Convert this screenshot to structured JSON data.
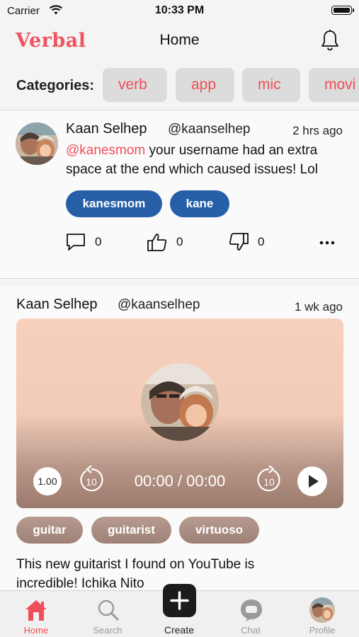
{
  "status_bar": {
    "carrier": "Carrier",
    "time": "10:33 PM"
  },
  "header": {
    "logo": "Verbal",
    "title": "Home"
  },
  "categories": {
    "label": "Categories:",
    "items": [
      "verb",
      "app",
      "mic",
      "movi"
    ]
  },
  "feed": {
    "post1": {
      "name": "Kaan Selhep",
      "handle": "@kaanselhep",
      "time": "2 hrs ago",
      "mention": "@kanesmom",
      "text_line1_rest": " your username had an extra",
      "text_line2": "space at the end which caused issues! Lol",
      "tags": [
        "kanesmom",
        "kane"
      ],
      "comments": "0",
      "likes": "0",
      "dislikes": "0"
    },
    "post2": {
      "name": "Kaan Selhep",
      "handle": "@kaanselhep",
      "time": "1 wk ago",
      "player": {
        "speed": "1.00",
        "timeline": "00:00 / 00:00",
        "skip_back": "10",
        "skip_forward": "10"
      },
      "tags": [
        "guitar",
        "guitarist",
        "virtuoso"
      ],
      "text_line1": "This new guitarist I found on YouTube is",
      "text_line2": "incredible! Ichika Nito"
    }
  },
  "tab_bar": {
    "home": "Home",
    "search": "Search",
    "create": "Create",
    "chat": "Chat",
    "profile": "Profile"
  },
  "colors": {
    "accent": "#ef4f58",
    "tag_blue": "#265fa8",
    "tag_brown": "#a88b80"
  }
}
